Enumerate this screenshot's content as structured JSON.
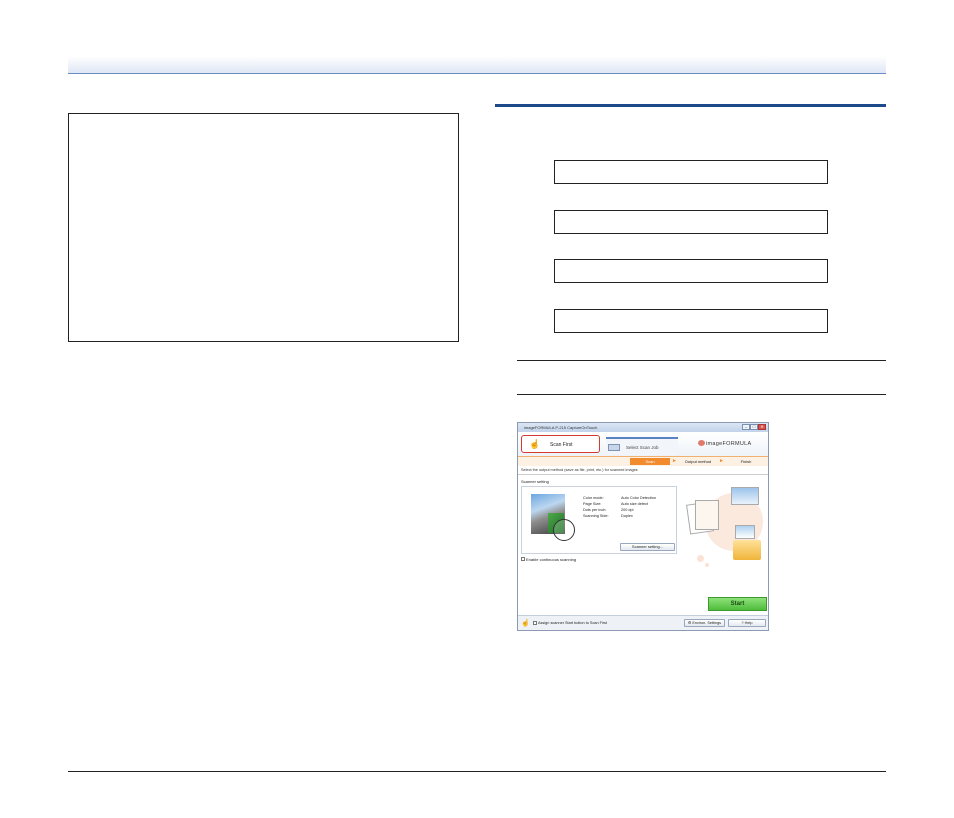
{
  "window": {
    "title": "imageFORMULA P-215 CaptureOnTouch",
    "controls": [
      "–",
      "□",
      "✕"
    ]
  },
  "toolbar": {
    "scan_first_label": "Scan First",
    "select_scan_job_label": "Select Scan Job",
    "logo_text": "imageFORMULA"
  },
  "progress": {
    "steps": [
      "Scan",
      "Output method",
      "Finish"
    ],
    "active": "Scan"
  },
  "instruction": "Select the output method (save as file, print, etc.) for scanned images",
  "scanner_setting": {
    "heading": "Scanner setting",
    "rows": [
      {
        "key": "Color mode:",
        "value": "Auto Color Detection"
      },
      {
        "key": "Page Size:",
        "value": "Auto size detect"
      },
      {
        "key": "Dots per inch:",
        "value": "200 dpi"
      },
      {
        "key": "Scanning Side:",
        "value": "Duplex"
      }
    ],
    "button_label": "Scanner setting..."
  },
  "continuous_scanning_label": "Enable continuous scanning",
  "start_label": "Start",
  "statusbar": {
    "assign_label": "Assign scanner Start button to Scan First",
    "env_settings_label": "Environ. Settings",
    "help_label": "Help"
  },
  "icons": [
    "hand-icon",
    "scanner-icon",
    "logo-icon",
    "gear-icon",
    "help-icon"
  ],
  "colors": {
    "highlight": "#d23b2f",
    "progress_active": "#f28a2e",
    "start_button": "#4fbc3c",
    "section_rule": "#1d4a8a"
  }
}
